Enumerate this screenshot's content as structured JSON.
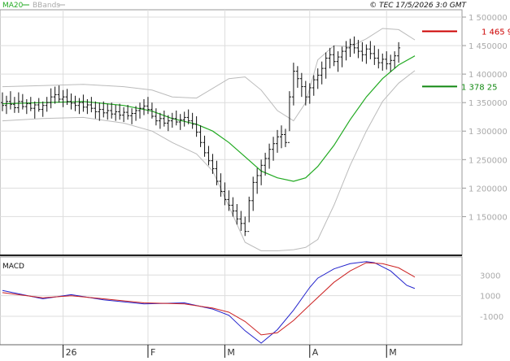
{
  "header": {
    "legend_ma": "MA20",
    "legend_bb": "BBands",
    "copyright": "© TEC 17/5/2026 3:0 GMT"
  },
  "colors": {
    "ma": "#22aa22",
    "bbands": "#bbbbbb",
    "bars": "#111111",
    "grid": "#dddddd",
    "last_price_line": "#cc0000",
    "ma_marker_line": "#118811",
    "macd_line": "#2222cc",
    "signal_line": "#cc2222"
  },
  "chart_data": [
    {
      "type": "ohlc",
      "name": "price",
      "ylim": [
        1085000,
        1510000
      ],
      "y_ticks": [
        1150000,
        1200000,
        1250000,
        1300000,
        1350000,
        1400000,
        1450000,
        1500000
      ],
      "y_tick_labels": [
        "1 150000",
        "1 200000",
        "1 250000",
        "1 300000",
        "1 350000",
        "1 400000",
        "1 450000",
        "1 500000"
      ],
      "x_index_range": [
        0,
        103
      ],
      "x_ticks": [
        15,
        36,
        55,
        76,
        95
      ],
      "x_tick_labels": [
        "26",
        "F",
        "M",
        "A",
        "M"
      ],
      "grid": true,
      "last_price": {
        "value": 1475000,
        "label": "1 465 9"
      },
      "ma_marker": {
        "value": 1378250,
        "label": "1 378 25"
      },
      "bars": [
        [
          1350000,
          1368000,
          1335000,
          1345000
        ],
        [
          1345000,
          1362000,
          1330000,
          1352000
        ],
        [
          1352000,
          1370000,
          1338000,
          1347000
        ],
        [
          1347000,
          1360000,
          1332000,
          1341000
        ],
        [
          1341000,
          1368000,
          1332000,
          1352000
        ],
        [
          1352000,
          1365000,
          1338000,
          1343000
        ],
        [
          1343000,
          1356000,
          1330000,
          1348000
        ],
        [
          1348000,
          1360000,
          1335000,
          1340000
        ],
        [
          1340000,
          1352000,
          1322000,
          1346000
        ],
        [
          1346000,
          1358000,
          1334000,
          1338000
        ],
        [
          1338000,
          1352000,
          1325000,
          1345000
        ],
        [
          1345000,
          1360000,
          1334000,
          1350000
        ],
        [
          1350000,
          1375000,
          1340000,
          1360000
        ],
        [
          1360000,
          1378000,
          1348000,
          1364000
        ],
        [
          1364000,
          1380000,
          1350000,
          1356000
        ],
        [
          1356000,
          1372000,
          1342000,
          1360000
        ],
        [
          1360000,
          1374000,
          1346000,
          1352000
        ],
        [
          1352000,
          1366000,
          1338000,
          1349000
        ],
        [
          1349000,
          1362000,
          1335000,
          1345000
        ],
        [
          1345000,
          1358000,
          1330000,
          1350000
        ],
        [
          1350000,
          1364000,
          1334000,
          1342000
        ],
        [
          1342000,
          1356000,
          1330000,
          1346000
        ],
        [
          1346000,
          1360000,
          1333000,
          1340000
        ],
        [
          1340000,
          1352000,
          1322000,
          1334000
        ],
        [
          1334000,
          1350000,
          1318000,
          1338000
        ],
        [
          1338000,
          1352000,
          1324000,
          1332000
        ],
        [
          1332000,
          1348000,
          1320000,
          1336000
        ],
        [
          1336000,
          1350000,
          1322000,
          1330000
        ],
        [
          1330000,
          1346000,
          1318000,
          1334000
        ],
        [
          1334000,
          1348000,
          1320000,
          1328000
        ],
        [
          1328000,
          1342000,
          1316000,
          1333000
        ],
        [
          1333000,
          1346000,
          1320000,
          1327000
        ],
        [
          1327000,
          1340000,
          1312000,
          1331000
        ],
        [
          1331000,
          1344000,
          1318000,
          1336000
        ],
        [
          1336000,
          1350000,
          1322000,
          1340000
        ],
        [
          1340000,
          1356000,
          1328000,
          1344000
        ],
        [
          1344000,
          1360000,
          1330000,
          1338000
        ],
        [
          1338000,
          1350000,
          1322000,
          1326000
        ],
        [
          1326000,
          1340000,
          1310000,
          1318000
        ],
        [
          1318000,
          1332000,
          1304000,
          1322000
        ],
        [
          1322000,
          1336000,
          1308000,
          1314000
        ],
        [
          1314000,
          1328000,
          1300000,
          1318000
        ],
        [
          1318000,
          1332000,
          1306000,
          1322000
        ],
        [
          1322000,
          1336000,
          1310000,
          1316000
        ],
        [
          1316000,
          1330000,
          1302000,
          1320000
        ],
        [
          1320000,
          1334000,
          1308000,
          1324000
        ],
        [
          1324000,
          1338000,
          1312000,
          1318000
        ],
        [
          1318000,
          1332000,
          1304000,
          1312000
        ],
        [
          1312000,
          1326000,
          1290000,
          1298000
        ],
        [
          1298000,
          1310000,
          1272000,
          1280000
        ],
        [
          1280000,
          1292000,
          1255000,
          1262000
        ],
        [
          1262000,
          1274000,
          1240000,
          1248000
        ],
        [
          1248000,
          1260000,
          1225000,
          1234000
        ],
        [
          1234000,
          1248000,
          1205000,
          1212000
        ],
        [
          1212000,
          1226000,
          1185000,
          1194000
        ],
        [
          1194000,
          1210000,
          1170000,
          1180000
        ],
        [
          1180000,
          1196000,
          1160000,
          1170000
        ],
        [
          1170000,
          1184000,
          1150000,
          1160000
        ],
        [
          1160000,
          1172000,
          1136000,
          1146000
        ],
        [
          1146000,
          1160000,
          1125000,
          1138000
        ],
        [
          1138000,
          1150000,
          1116000,
          1124000
        ],
        [
          1124000,
          1185000,
          1140000,
          1178000
        ],
        [
          1178000,
          1220000,
          1160000,
          1210000
        ],
        [
          1210000,
          1235000,
          1190000,
          1222000
        ],
        [
          1222000,
          1250000,
          1205000,
          1240000
        ],
        [
          1240000,
          1262000,
          1222000,
          1252000
        ],
        [
          1252000,
          1278000,
          1234000,
          1268000
        ],
        [
          1268000,
          1290000,
          1248000,
          1278000
        ],
        [
          1278000,
          1302000,
          1262000,
          1290000
        ],
        [
          1290000,
          1310000,
          1270000,
          1294000
        ],
        [
          1294000,
          1304000,
          1272000,
          1280000
        ],
        [
          1280000,
          1370000,
          1300000,
          1360000
        ],
        [
          1360000,
          1420000,
          1345000,
          1405000
        ],
        [
          1405000,
          1414000,
          1376000,
          1392000
        ],
        [
          1392000,
          1402000,
          1360000,
          1378000
        ],
        [
          1378000,
          1388000,
          1345000,
          1360000
        ],
        [
          1360000,
          1384000,
          1348000,
          1376000
        ],
        [
          1376000,
          1398000,
          1362000,
          1390000
        ],
        [
          1390000,
          1410000,
          1374000,
          1398000
        ],
        [
          1398000,
          1422000,
          1382000,
          1410000
        ],
        [
          1410000,
          1438000,
          1392000,
          1428000
        ],
        [
          1428000,
          1446000,
          1410000,
          1434000
        ],
        [
          1434000,
          1450000,
          1414000,
          1422000
        ],
        [
          1422000,
          1440000,
          1404000,
          1430000
        ],
        [
          1430000,
          1448000,
          1412000,
          1440000
        ],
        [
          1440000,
          1458000,
          1424000,
          1446000
        ],
        [
          1446000,
          1462000,
          1430000,
          1452000
        ],
        [
          1452000,
          1466000,
          1436000,
          1446000
        ],
        [
          1446000,
          1460000,
          1428000,
          1440000
        ],
        [
          1440000,
          1456000,
          1422000,
          1434000
        ],
        [
          1434000,
          1452000,
          1418000,
          1444000
        ],
        [
          1444000,
          1458000,
          1426000,
          1436000
        ],
        [
          1436000,
          1450000,
          1416000,
          1428000
        ],
        [
          1428000,
          1444000,
          1410000,
          1420000
        ],
        [
          1420000,
          1436000,
          1406000,
          1426000
        ],
        [
          1426000,
          1440000,
          1408000,
          1418000
        ],
        [
          1418000,
          1434000,
          1404000,
          1424000
        ],
        [
          1424000,
          1440000,
          1410000,
          1432000
        ],
        [
          1432000,
          1456000,
          1420000,
          1446000
        ]
      ],
      "ma20": [
        [
          0,
          1348000
        ],
        [
          10,
          1350000
        ],
        [
          20,
          1352000
        ],
        [
          30,
          1345000
        ],
        [
          37,
          1335000
        ],
        [
          42,
          1322000
        ],
        [
          48,
          1312000
        ],
        [
          52,
          1300000
        ],
        [
          56,
          1280000
        ],
        [
          60,
          1255000
        ],
        [
          64,
          1230000
        ],
        [
          68,
          1218000
        ],
        [
          72,
          1212000
        ],
        [
          75,
          1218000
        ],
        [
          78,
          1238000
        ],
        [
          82,
          1275000
        ],
        [
          86,
          1320000
        ],
        [
          90,
          1360000
        ],
        [
          94,
          1392000
        ],
        [
          98,
          1416000
        ],
        [
          102,
          1432000
        ]
      ],
      "bb_upper": [
        [
          0,
          1378000
        ],
        [
          10,
          1380000
        ],
        [
          20,
          1382000
        ],
        [
          30,
          1378000
        ],
        [
          37,
          1372000
        ],
        [
          42,
          1360000
        ],
        [
          48,
          1358000
        ],
        [
          52,
          1375000
        ],
        [
          56,
          1392000
        ],
        [
          60,
          1395000
        ],
        [
          64,
          1372000
        ],
        [
          68,
          1336000
        ],
        [
          72,
          1318000
        ],
        [
          75,
          1350000
        ],
        [
          78,
          1425000
        ],
        [
          82,
          1450000
        ],
        [
          86,
          1448000
        ],
        [
          90,
          1462000
        ],
        [
          94,
          1480000
        ],
        [
          98,
          1478000
        ],
        [
          102,
          1460000
        ]
      ],
      "bb_lower": [
        [
          0,
          1318000
        ],
        [
          10,
          1322000
        ],
        [
          20,
          1324000
        ],
        [
          30,
          1314000
        ],
        [
          37,
          1300000
        ],
        [
          42,
          1280000
        ],
        [
          48,
          1260000
        ],
        [
          52,
          1230000
        ],
        [
          56,
          1168000
        ],
        [
          60,
          1105000
        ],
        [
          64,
          1090000
        ],
        [
          68,
          1090000
        ],
        [
          72,
          1092000
        ],
        [
          75,
          1096000
        ],
        [
          78,
          1110000
        ],
        [
          82,
          1170000
        ],
        [
          86,
          1240000
        ],
        [
          90,
          1300000
        ],
        [
          94,
          1352000
        ],
        [
          98,
          1384000
        ],
        [
          102,
          1406000
        ]
      ]
    },
    {
      "type": "line",
      "name": "MACD",
      "title": "MACD",
      "ylim": [
        -3600,
        4600
      ],
      "y_ticks": [
        3000,
        1000,
        -1000
      ],
      "y_tick_labels": [
        "3000",
        "1000",
        "-1000"
      ],
      "grid": true,
      "series": [
        {
          "name": "MACD",
          "color": "#2222cc",
          "points": [
            [
              0,
              1500
            ],
            [
              10,
              700
            ],
            [
              17,
              1100
            ],
            [
              25,
              600
            ],
            [
              35,
              200
            ],
            [
              45,
              300
            ],
            [
              52,
              -300
            ],
            [
              56,
              -900
            ],
            [
              60,
              -2400
            ],
            [
              64,
              -3600
            ],
            [
              68,
              -2300
            ],
            [
              72,
              -400
            ],
            [
              76,
              1800
            ],
            [
              78,
              2700
            ],
            [
              82,
              3600
            ],
            [
              86,
              4100
            ],
            [
              90,
              4300
            ],
            [
              92,
              4200
            ],
            [
              96,
              3400
            ],
            [
              100,
              2000
            ],
            [
              102,
              1700
            ]
          ]
        },
        {
          "name": "Signal",
          "color": "#cc2222",
          "points": [
            [
              0,
              1300
            ],
            [
              10,
              800
            ],
            [
              17,
              1000
            ],
            [
              25,
              700
            ],
            [
              35,
              300
            ],
            [
              45,
              200
            ],
            [
              52,
              -200
            ],
            [
              56,
              -600
            ],
            [
              60,
              -1500
            ],
            [
              64,
              -2800
            ],
            [
              68,
              -2600
            ],
            [
              72,
              -1400
            ],
            [
              76,
              100
            ],
            [
              82,
              2300
            ],
            [
              86,
              3400
            ],
            [
              90,
              4200
            ],
            [
              94,
              4100
            ],
            [
              98,
              3700
            ],
            [
              102,
              2800
            ]
          ]
        }
      ]
    }
  ]
}
